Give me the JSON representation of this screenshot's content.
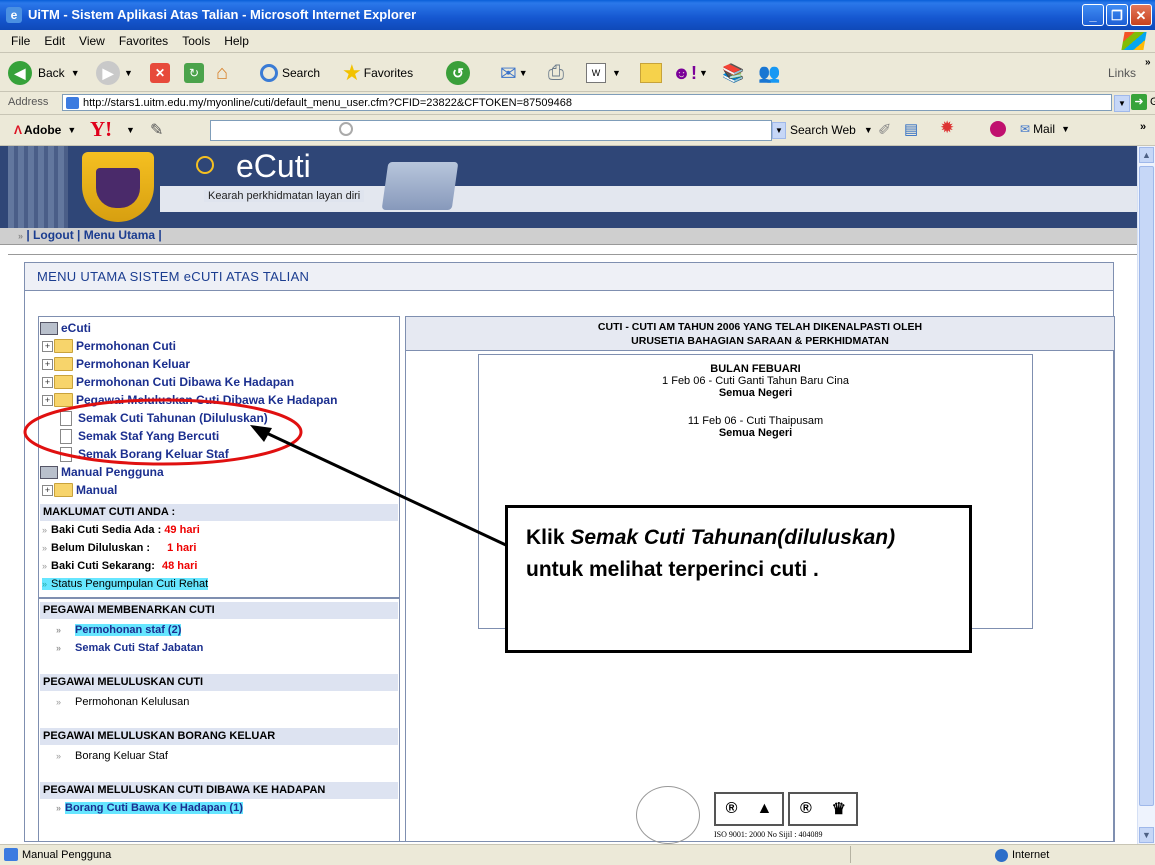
{
  "window": {
    "title": "UiTM - Sistem Aplikasi Atas Talian - Microsoft Internet Explorer"
  },
  "menubar": [
    "File",
    "Edit",
    "View",
    "Favorites",
    "Tools",
    "Help"
  ],
  "toolbar": {
    "back": "Back",
    "search": "Search",
    "favorites": "Favorites",
    "links": "Links"
  },
  "address": {
    "label": "Address",
    "url": "http://stars1.uitm.edu.my/myonline/cuti/default_menu_user.cfm?CFID=23822&CFTOKEN=87509468",
    "go": "Go"
  },
  "ybar": {
    "adobe": "Adobe",
    "search_web": "Search Web",
    "mail": "Mail"
  },
  "banner": {
    "brand": "eCuti",
    "tagline": "Kearah perkhidmatan layan diri"
  },
  "links": {
    "logout": "Logout",
    "menu_utama": "Menu Utama"
  },
  "main": {
    "title": "MENU UTAMA SISTEM eCUTI ATAS TALIAN",
    "tree": {
      "root": "eCuti",
      "items": [
        "Permohonan Cuti",
        "Permohonan Keluar",
        "Permohonan Cuti Dibawa Ke Hadapan",
        "Pegawai Meluluskan Cuti Dibawa Ke Hadapan"
      ],
      "docs": [
        "Semak Cuti Tahunan (Diluluskan)",
        "Semak Staf Yang Bercuti",
        "Semak Borang Keluar Staf"
      ],
      "manual_root": "Manual Pengguna",
      "manual": "Manual"
    },
    "maklumat": {
      "title": "MAKLUMAT CUTI ANDA :",
      "rows": [
        {
          "label": "Baki Cuti Sedia Ada :",
          "value": "49 hari"
        },
        {
          "label": "Belum Diluluskan :",
          "value": "1 hari"
        },
        {
          "label": "Baki Cuti Sekarang:",
          "value": "48 hari"
        }
      ],
      "status": "Status Pengumpulan Cuti Rehat"
    },
    "sections": [
      {
        "title": "PEGAWAI MEMBENARKAN CUTI",
        "items": [
          "Permohonan staf (2)",
          "Semak Cuti Staf Jabatan"
        ]
      },
      {
        "title": "PEGAWAI MELULUSKAN CUTI",
        "items": [
          "Permohonan Kelulusan"
        ]
      },
      {
        "title": "PEGAWAI MELULUSKAN BORANG KELUAR",
        "items": [
          "Borang Keluar Staf"
        ]
      },
      {
        "title": "PEGAWAI MELULUSKAN CUTI DIBAWA KE HADAPAN",
        "items": [
          "Borang Cuti Bawa Ke Hadapan  (1)"
        ]
      }
    ],
    "holiday": {
      "head1": "CUTI - CUTI AM TAHUN 2006 YANG TELAH DIKENALPASTI OLEH",
      "head2": "URUSETIA BAHAGIAN SARAAN & PERKHIDMATAN",
      "month": "BULAN FEBUARI",
      "entries": [
        {
          "text": "1 Feb 06 - Cuti Ganti Tahun Baru Cina",
          "scope": "Semua Negeri"
        },
        {
          "text": "11 Feb 06 - Cuti Thaipusam",
          "scope": "Semua Negeri"
        }
      ]
    },
    "iso": "ISO 9001: 2000  No Sijil : 404089"
  },
  "callout": {
    "prefix": "Klik ",
    "italic": "Semak Cuti Tahunan(diluluskan)",
    "suffix": " untuk melihat terperinci cuti ."
  },
  "status": {
    "left": "Manual Pengguna",
    "zone": "Internet"
  }
}
